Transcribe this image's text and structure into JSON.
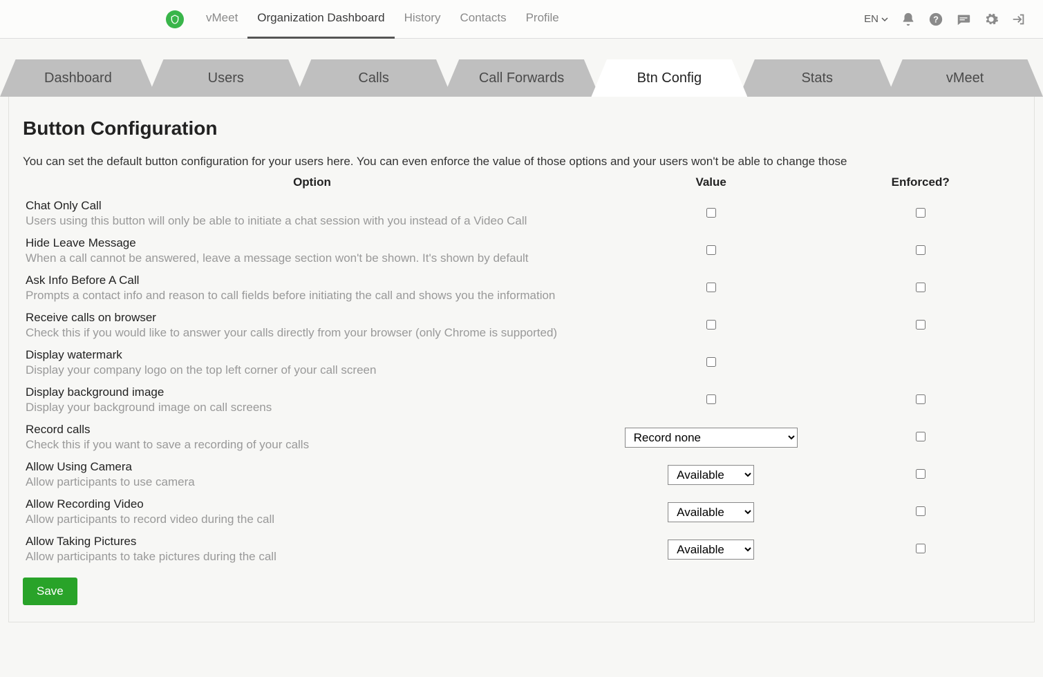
{
  "header": {
    "brand": "vMeet",
    "nav": [
      {
        "label": "vMeet",
        "active": false
      },
      {
        "label": "Organization Dashboard",
        "active": true
      },
      {
        "label": "History",
        "active": false
      },
      {
        "label": "Contacts",
        "active": false
      },
      {
        "label": "Profile",
        "active": false
      }
    ],
    "language": "EN"
  },
  "tabs": [
    {
      "label": "Dashboard",
      "active": false
    },
    {
      "label": "Users",
      "active": false
    },
    {
      "label": "Calls",
      "active": false
    },
    {
      "label": "Call Forwards",
      "active": false
    },
    {
      "label": "Btn Config",
      "active": true
    },
    {
      "label": "Stats",
      "active": false
    },
    {
      "label": "vMeet",
      "active": false
    }
  ],
  "page": {
    "title": "Button Configuration",
    "intro": "You can set the default button configuration for your users here. You can even enforce the value of those options and your users won't be able to change those",
    "columns": {
      "option": "Option",
      "value": "Value",
      "enforced": "Enforced?"
    },
    "save_label": "Save"
  },
  "select_defaults": {
    "record": "Record none",
    "available": "Available"
  },
  "options": [
    {
      "title": "Chat Only Call",
      "desc": "Users using this button will only be able to initiate a chat session with you instead of a Video Call",
      "type": "checkbox",
      "has_enforced": true
    },
    {
      "title": "Hide Leave Message",
      "desc": "When a call cannot be answered, leave a message section won't be shown. It's shown by default",
      "type": "checkbox",
      "has_enforced": true
    },
    {
      "title": "Ask Info Before A Call",
      "desc": "Prompts a contact info and reason to call fields before initiating the call and shows you the information",
      "type": "checkbox",
      "has_enforced": true
    },
    {
      "title": "Receive calls on browser",
      "desc": "Check this if you would like to answer your calls directly from your browser (only Chrome is supported)",
      "type": "checkbox",
      "has_enforced": true
    },
    {
      "title": "Display watermark",
      "desc": "Display your company logo on the top left corner of your call screen",
      "type": "checkbox",
      "has_enforced": false
    },
    {
      "title": "Display background image",
      "desc": "Display your background image on call screens",
      "type": "checkbox",
      "has_enforced": true
    },
    {
      "title": "Record calls",
      "desc": "Check this if you want to save a recording of your calls",
      "type": "select-record",
      "has_enforced": true
    },
    {
      "title": "Allow Using Camera",
      "desc": "Allow participants to use camera",
      "type": "select-available",
      "has_enforced": true
    },
    {
      "title": "Allow Recording Video",
      "desc": "Allow participants to record video during the call",
      "type": "select-available",
      "has_enforced": true
    },
    {
      "title": "Allow Taking Pictures",
      "desc": "Allow participants to take pictures during the call",
      "type": "select-available",
      "has_enforced": true
    }
  ]
}
